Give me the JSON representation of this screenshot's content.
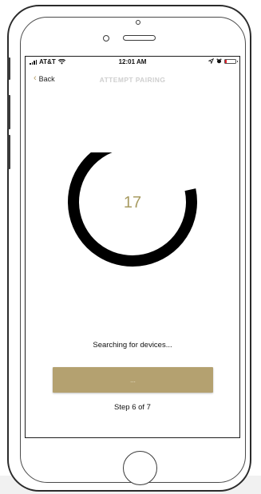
{
  "status_bar": {
    "carrier": "AT&T",
    "time": "12:01 AM",
    "battery_level": 0.15,
    "colors": {
      "battery_low": "#e0202a"
    },
    "icons": [
      "signal-icon",
      "wifi-icon",
      "location-icon",
      "alarm-icon",
      "battery-icon"
    ]
  },
  "nav": {
    "back_label": "Back",
    "title": "ATTEMPT PAIRING"
  },
  "pairing": {
    "countdown": "17",
    "progress": 0.78,
    "status_text": "Searching for devices...",
    "button_label": "...",
    "step_text": "Step 6 of 7"
  },
  "colors": {
    "accent": "#b4a170",
    "countdown": "#a89c62",
    "ring": "#000000",
    "title_gray": "#cfcfcf"
  }
}
